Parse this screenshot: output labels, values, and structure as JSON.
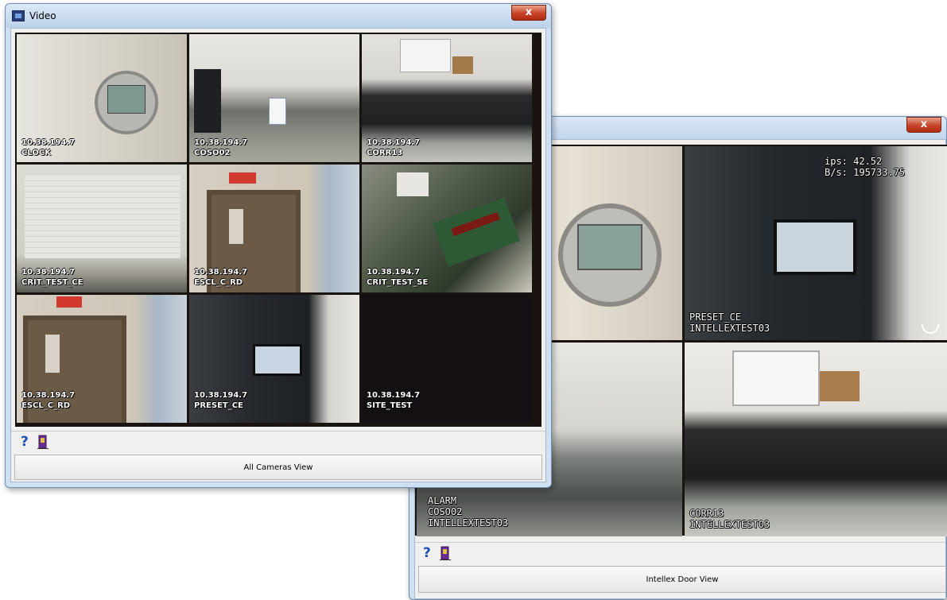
{
  "window1": {
    "title": "Video",
    "close": "x",
    "cameras": [
      {
        "ip": "10.38.194.7",
        "name": "CLOCK"
      },
      {
        "ip": "10.38.194.7",
        "name": "COSO02"
      },
      {
        "ip": "10.38.194.7",
        "name": "CORR13"
      },
      {
        "ip": "10.38.194.7",
        "name": "CRIT_TEST_CE"
      },
      {
        "ip": "10.38.194.7",
        "name": "ESCL_C_RD"
      },
      {
        "ip": "10.38.194.7",
        "name": "CRIT_TEST_SE"
      },
      {
        "ip": "10.38.194.7",
        "name": "ESCL_C_RD"
      },
      {
        "ip": "10.38.194.7",
        "name": "PRESET_CE"
      },
      {
        "ip": "10.38.194.7",
        "name": "SITE_TEST"
      }
    ],
    "view_button": "All Cameras View"
  },
  "window2": {
    "close": "x",
    "stats": {
      "ips": "ips: 42.52",
      "bps": "B/s: 195733.75"
    },
    "cameras": [
      {
        "lines": []
      },
      {
        "lines": [
          "PRESET_CE",
          "INTELLEXTEST03"
        ]
      },
      {
        "lines": [
          "ALARM",
          "COSO02",
          "INTELLEXTEST03"
        ]
      },
      {
        "lines": [
          "CORR13",
          "INTELLEXTEST03"
        ]
      }
    ],
    "view_button": "Intellex Door View"
  },
  "icons": {
    "help": "?",
    "help_name": "help-icon",
    "door_name": "exit-door-icon"
  }
}
